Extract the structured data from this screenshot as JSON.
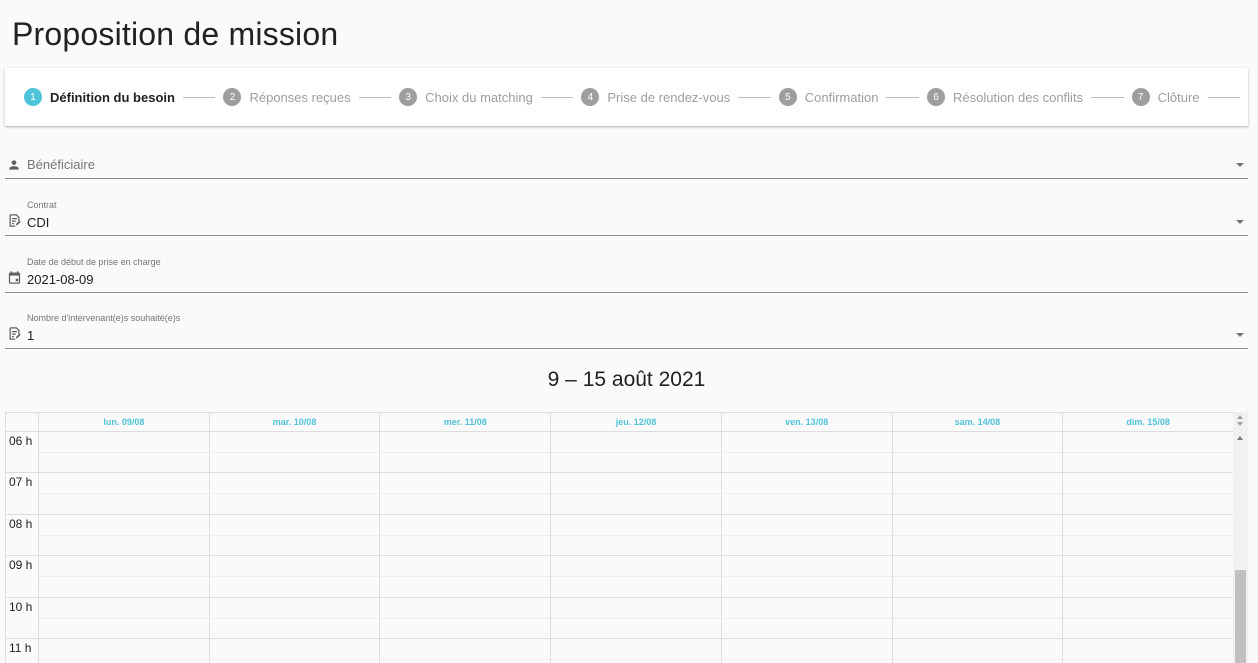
{
  "page": {
    "title": "Proposition de mission"
  },
  "stepper": {
    "steps": [
      {
        "number": "1",
        "label": "Définition du besoin",
        "active": true
      },
      {
        "number": "2",
        "label": "Réponses reçues",
        "active": false
      },
      {
        "number": "3",
        "label": "Choix du matching",
        "active": false
      },
      {
        "number": "4",
        "label": "Prise de rendez-vous",
        "active": false
      },
      {
        "number": "5",
        "label": "Confirmation",
        "active": false
      },
      {
        "number": "6",
        "label": "Résolution des conflits",
        "active": false
      },
      {
        "number": "7",
        "label": "Clôture",
        "active": false
      }
    ],
    "active_color": "#4fc3d9",
    "inactive_color": "#9e9e9e"
  },
  "form": {
    "beneficiaire": {
      "placeholder": "Bénéficiaire",
      "icon": "person-icon"
    },
    "contrat": {
      "label": "Contrat",
      "value": "CDI",
      "icon": "edit-document-icon"
    },
    "date_debut": {
      "label": "Date de début de prise en charge",
      "value": "2021-08-09",
      "icon": "calendar-icon"
    },
    "nombre_intervenants": {
      "label": "Nombre d'intervenant(e)s souhaité(e)s",
      "value": "1",
      "icon": "edit-document-icon"
    }
  },
  "calendar": {
    "title": "9 – 15 août 2021",
    "days": [
      "lun. 09/08",
      "mar. 10/08",
      "mer. 11/08",
      "jeu. 12/08",
      "ven. 13/08",
      "sam. 14/08",
      "dim. 15/08"
    ],
    "hours": [
      "06 h",
      "07 h",
      "08 h",
      "09 h",
      "10 h",
      "11 h"
    ],
    "header_color": "#4fc3d9"
  }
}
